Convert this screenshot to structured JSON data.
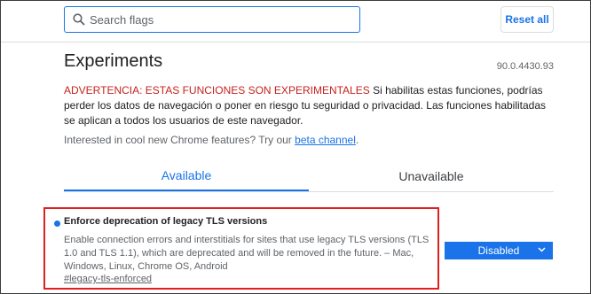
{
  "search": {
    "placeholder": "Search flags"
  },
  "header": {
    "reset_label": "Reset all"
  },
  "page": {
    "title": "Experiments",
    "version": "90.0.4430.93",
    "warning_strong": "ADVERTENCIA: ESTAS FUNCIONES SON EXPERIMENTALES",
    "warning_rest": " Si habilitas estas funciones, podrías perder los datos de navegación o poner en riesgo tu seguridad o privacidad. Las funciones habilitadas se aplican a todos los usuarios de este navegador.",
    "promo_text": "Interested in cool new Chrome features? Try our ",
    "promo_link": "beta channel",
    "promo_end": "."
  },
  "tabs": [
    {
      "label": "Available"
    },
    {
      "label": "Unavailable"
    }
  ],
  "experiment": {
    "name": "Enforce deprecation of legacy TLS versions",
    "description": "Enable connection errors and interstitials for sites that use legacy TLS versions (TLS 1.0 and TLS 1.1), which are deprecated and will be removed in the future. – Mac, Windows, Linux, Chrome OS, Android",
    "link": "#legacy-tls-enforced",
    "state": "Disabled"
  },
  "colors": {
    "accent": "#1a73e8",
    "warning": "#c5221f",
    "highlight_border": "#e02020"
  },
  "icons": {
    "search": "search-icon",
    "dropdown": "chevron-down-icon"
  }
}
